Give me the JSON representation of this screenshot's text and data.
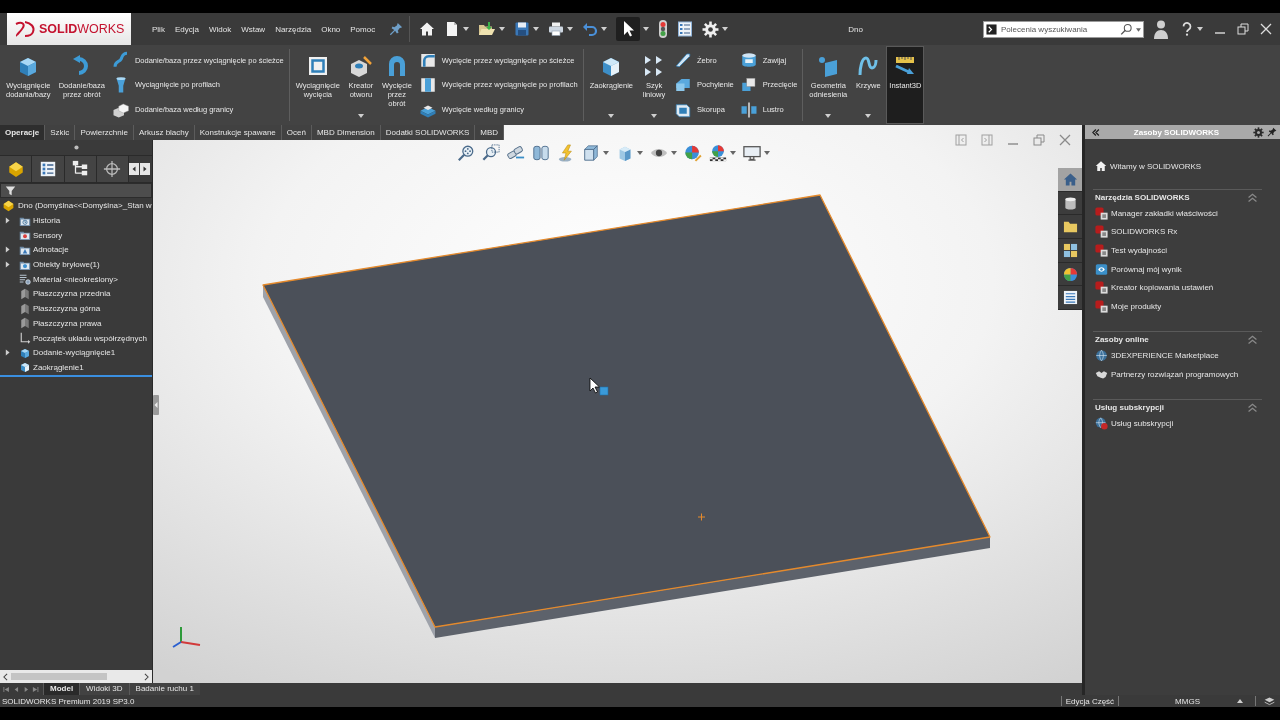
{
  "title_bar": {
    "logo": "**SOLID**WORKS",
    "menus": [
      "Plik",
      "Edycja",
      "Widok",
      "Wstaw",
      "Narzędzia",
      "Okno",
      "Pomoc"
    ],
    "document_title": "Dno",
    "search": {
      "placeholder": "Polecenia wyszukiwania"
    }
  },
  "ribbon": {
    "groups": [
      {
        "items": [
          {
            "kind": "large",
            "label": "Wyciągnięcie\ndodania/bazy",
            "dropdown": false,
            "on": false
          },
          {
            "kind": "large",
            "label": "Dodanie/baza\nprzez obrót",
            "dropdown": false,
            "on": false
          },
          {
            "kind": "stack",
            "items": [
              "Dodanie/baza przez wyciągnięcie po ścieżce",
              "Wyciągnięcie po profilach",
              "Dodanie/baza według granicy"
            ]
          }
        ]
      },
      {
        "items": [
          {
            "kind": "large",
            "label": "Wyciągnięcie\nwycięcia",
            "dropdown": false,
            "on": false
          },
          {
            "kind": "large",
            "label": "Kreator\notworu",
            "dropdown": true,
            "on": false
          },
          {
            "kind": "large",
            "label": "Wycięcie\nprzez\nobrót",
            "dropdown": false,
            "on": false
          },
          {
            "kind": "stack",
            "items": [
              "Wycięcie przez wyciągnięcie po ścieżce",
              "Wycięcie przez wyciągnięcie po profilach",
              "Wycięcie według granicy"
            ]
          }
        ]
      },
      {
        "items": [
          {
            "kind": "large",
            "label": "Zaokrąglenie",
            "dropdown": true,
            "on": false
          },
          {
            "kind": "large",
            "label": "Szyk\nliniowy",
            "dropdown": true,
            "on": false
          },
          {
            "kind": "stack",
            "items": [
              "Żebro",
              "Pochylenie",
              "Skorupa"
            ]
          },
          {
            "kind": "stack",
            "items": [
              "Zawijaj",
              "Przecięcie",
              "Lustro"
            ]
          }
        ]
      },
      {
        "items": [
          {
            "kind": "large",
            "label": "Geometria\nodniesienia",
            "dropdown": true,
            "on": false
          },
          {
            "kind": "large",
            "label": "Krzywe",
            "dropdown": true,
            "on": false
          },
          {
            "kind": "large",
            "label": "Instant3D",
            "dropdown": false,
            "on": true
          }
        ]
      }
    ]
  },
  "command_tabs": [
    {
      "label": "Operacje",
      "selected": true
    },
    {
      "label": "Szkic",
      "selected": false
    },
    {
      "label": "Powierzchnie",
      "selected": false
    },
    {
      "label": "Arkusz blachy",
      "selected": false
    },
    {
      "label": "Konstrukcje spawane",
      "selected": false
    },
    {
      "label": "Oceń",
      "selected": false
    },
    {
      "label": "MBD Dimension",
      "selected": false
    },
    {
      "label": "Dodatki SOLIDWORKS",
      "selected": false
    },
    {
      "label": "MBD",
      "selected": false
    }
  ],
  "feature_tree": {
    "root": {
      "label": "Dno (Domyślna<<Domyślna>_Stan w",
      "children": [
        {
          "label": "Historia",
          "kind": "history",
          "expandable": true
        },
        {
          "label": "Sensory",
          "kind": "sensors",
          "expandable": false
        },
        {
          "label": "Adnotacje",
          "kind": "annotations",
          "expandable": true
        },
        {
          "label": "Obiekty bryłowe(1)",
          "kind": "bodies",
          "expandable": true
        },
        {
          "label": "Materiał <nieokreślony>",
          "kind": "material",
          "expandable": false
        },
        {
          "label": "Płaszczyzna przednia",
          "kind": "plane",
          "expandable": false
        },
        {
          "label": "Płaszczyzna górna",
          "kind": "plane",
          "expandable": false
        },
        {
          "label": "Płaszczyzna prawa",
          "kind": "plane",
          "expandable": false
        },
        {
          "label": "Początek układu współrzędnych",
          "kind": "origin",
          "expandable": false
        },
        {
          "label": "Dodanie-wyciągnięcie1",
          "kind": "extrude",
          "expandable": true
        },
        {
          "label": "Zaokrąglenie1",
          "kind": "fillet",
          "expandable": false
        }
      ]
    }
  },
  "document_tabs": [
    {
      "label": "Model",
      "selected": true
    },
    {
      "label": "Widoki 3D",
      "selected": false
    },
    {
      "label": "Badanie ruchu 1",
      "selected": false
    }
  ],
  "task_pane": {
    "title": "Zasoby SOLIDWORKS",
    "tabs": [
      {
        "selected": true
      },
      {
        "selected": false
      },
      {
        "selected": false
      },
      {
        "selected": false
      },
      {
        "selected": false
      },
      {
        "selected": false
      }
    ],
    "welcome": "Witamy w SOLIDWORKS",
    "sections": [
      {
        "title": "Narzędzia SOLIDWORKS",
        "expanded": true,
        "items": [
          "Manager zakładki właściwości",
          "SOLIDWORKS Rx",
          "Test wydajności",
          "Porównaj mój wynik",
          "Kreator kopiowania ustawień",
          "Moje produkty"
        ]
      },
      {
        "title": "Zasoby online",
        "expanded": true,
        "items": [
          "3DEXPERIENCE Marketplace",
          "Partnerzy rozwiązań programowych"
        ]
      },
      {
        "title": "Usług subskrypcji",
        "expanded": true,
        "items": [
          "Usług subskrypcji"
        ]
      }
    ]
  },
  "status_bar": {
    "product": "SOLIDWORKS Premium 2019 SP3.0",
    "mode": "Edycja Część",
    "units": "MMGS"
  }
}
